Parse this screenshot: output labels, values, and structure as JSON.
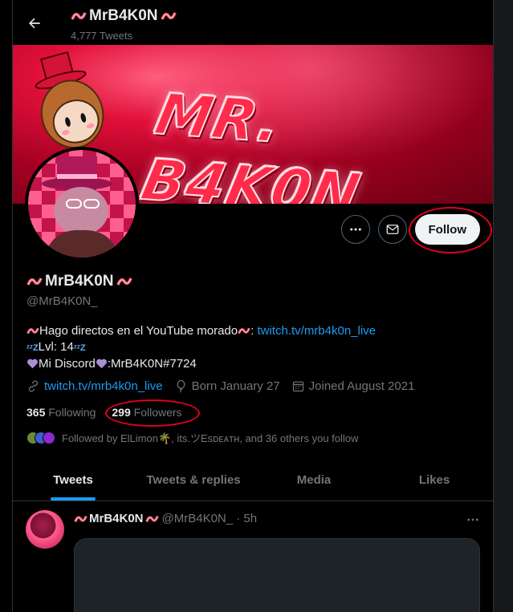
{
  "header": {
    "name": "MrB4K0N",
    "tweet_count": "4,777 Tweets"
  },
  "banner": {
    "title": "MR. B4K0N"
  },
  "actions": {
    "follow_label": "Follow"
  },
  "profile": {
    "name": "MrB4K0N",
    "handle": "@MrB4K0N_",
    "bio": {
      "line1_text": "Hago directos en el YouTube morado",
      "line1_sep": ":",
      "line1_link": "twitch.tv/mrb4k0n_live",
      "line2_text": "Lvl: 14",
      "line3_text1": "Mi Discord",
      "line3_text2": ":MrB4K0N#7724"
    },
    "meta": {
      "website": "twitch.tv/mrb4k0n_live",
      "birthday": "Born January 27",
      "joined": "Joined August 2021"
    },
    "stats": {
      "following_count": "365",
      "following_label": "Following",
      "followers_count": "299",
      "followers_label": "Followers"
    },
    "followed_by": "Followed by ElLimon🌴, its.ツEsᴅᴇᴀᴛʜ, and 36 others you follow"
  },
  "tabs": [
    {
      "label": "Tweets",
      "active": true
    },
    {
      "label": "Tweets & replies",
      "active": false
    },
    {
      "label": "Media",
      "active": false
    },
    {
      "label": "Likes",
      "active": false
    }
  ],
  "tweet": {
    "name": "MrB4K0N",
    "handle_time": "@MrB4K0N_ · 5h"
  },
  "colors": {
    "accent": "#1d9bf0",
    "annotation": "#e0001f",
    "background": "#000000"
  },
  "icons": [
    "back-arrow-icon",
    "more-icon",
    "mail-icon",
    "link-icon",
    "balloon-icon",
    "calendar-icon",
    "bacon-icon",
    "purple-heart-icon",
    "zzz-icon"
  ]
}
